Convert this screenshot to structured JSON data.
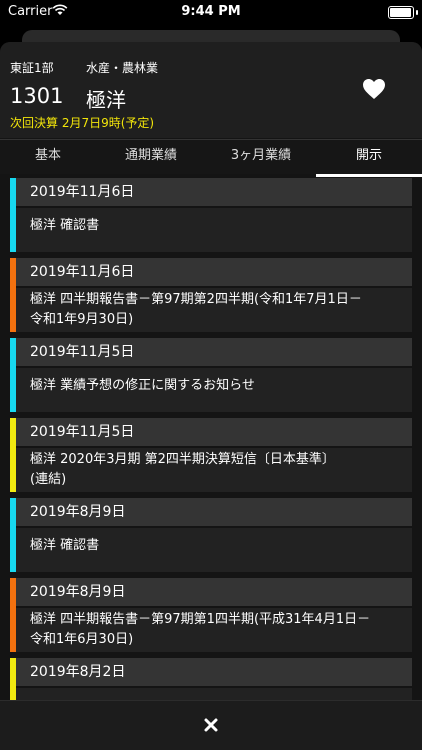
{
  "status": {
    "carrier": "Carrier",
    "time": "9:44 PM"
  },
  "stock": {
    "market": "東証1部",
    "sector": "水産・農林業",
    "code": "1301",
    "name": "極洋",
    "next_earnings": "次回決算 2月7日9時(予定)"
  },
  "tabs": [
    "基本",
    "通期業績",
    "3ヶ月業績",
    "開示"
  ],
  "disclosures": [
    {
      "date": "2019年11月6日",
      "lines": [
        "極洋 確認書"
      ],
      "color": "#17d9f0"
    },
    {
      "date": "2019年11月6日",
      "lines": [
        "極洋 四半期報告書－第97期第2四半期(令和1年7月1日－",
        "令和1年9月30日)"
      ],
      "color": "#f2710f"
    },
    {
      "date": "2019年11月5日",
      "lines": [
        "極洋 業績予想の修正に関するお知らせ"
      ],
      "color": "#17d9f0"
    },
    {
      "date": "2019年11月5日",
      "lines": [
        "極洋 2020年3月期 第2四半期決算短信〔日本基準〕",
        "(連結)"
      ],
      "color": "#f1ea10"
    },
    {
      "date": "2019年8月9日",
      "lines": [
        "極洋 確認書"
      ],
      "color": "#17d9f0"
    },
    {
      "date": "2019年8月9日",
      "lines": [
        "極洋 四半期報告書－第97期第1四半期(平成31年4月1日－",
        "令和1年6月30日)"
      ],
      "color": "#f2710f"
    },
    {
      "date": "2019年8月2日",
      "lines": [],
      "color": "#f1ea10"
    }
  ],
  "icons": {
    "heart": "heart-icon",
    "close": "close-icon"
  }
}
